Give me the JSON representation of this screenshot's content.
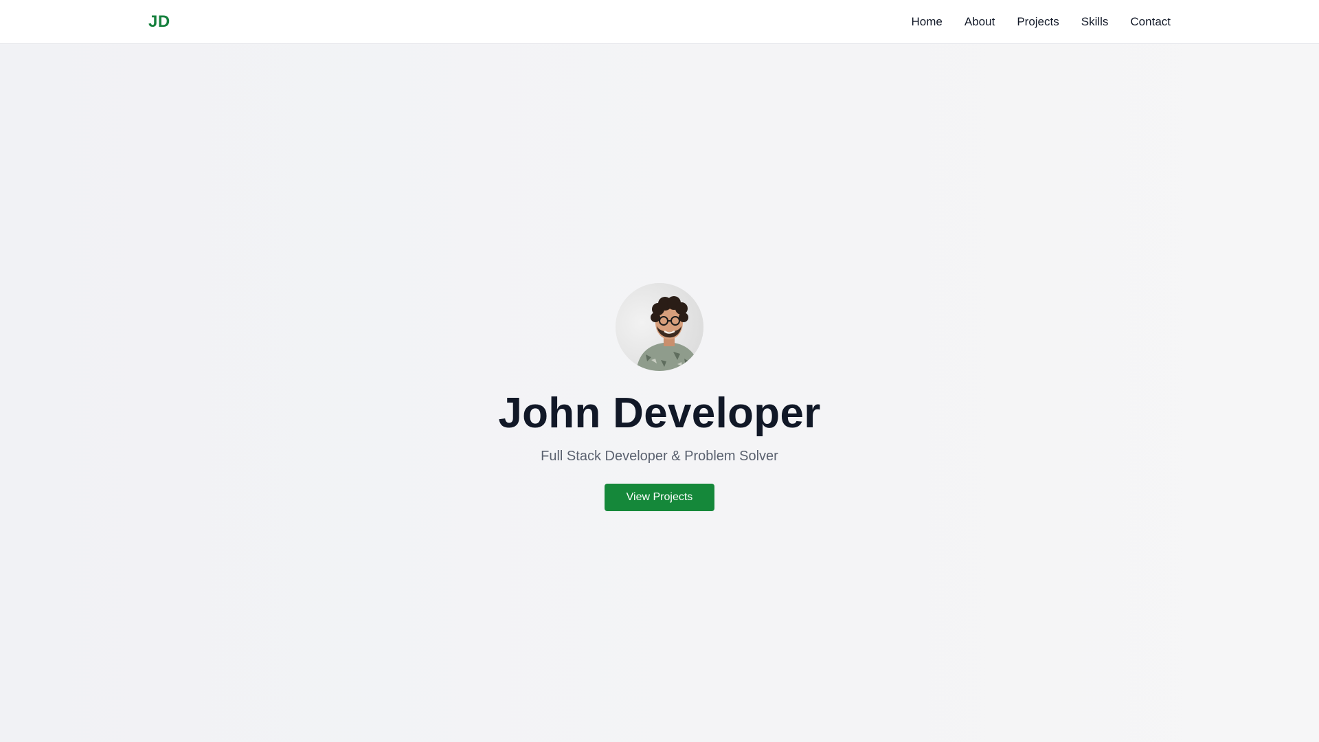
{
  "brand": {
    "logo_text": "JD",
    "accent_color": "#15803d"
  },
  "nav": {
    "items": [
      {
        "label": "Home"
      },
      {
        "label": "About"
      },
      {
        "label": "Projects"
      },
      {
        "label": "Skills"
      },
      {
        "label": "Contact"
      }
    ]
  },
  "hero": {
    "avatar_alt": "avatar",
    "name": "John Developer",
    "tagline": "Full Stack Developer & Problem Solver",
    "cta_label": "View Projects",
    "cta_color": "#15883a"
  }
}
